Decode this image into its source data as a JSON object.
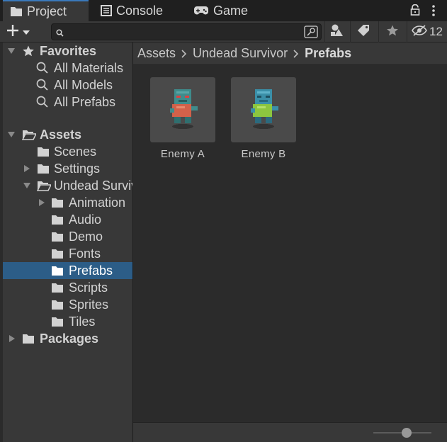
{
  "tabs": [
    {
      "label": "Project",
      "icon": "folder-icon",
      "active": true
    },
    {
      "label": "Console",
      "icon": "console-icon",
      "active": false
    },
    {
      "label": "Game",
      "icon": "gamepad-icon",
      "active": false
    }
  ],
  "toolbar": {
    "search_value": "",
    "hidden_count": "12"
  },
  "tree": {
    "favorites": {
      "label": "Favorites",
      "items": [
        {
          "label": "All Materials"
        },
        {
          "label": "All Models"
        },
        {
          "label": "All Prefabs"
        }
      ]
    },
    "assets": {
      "label": "Assets",
      "scenes": "Scenes",
      "settings": "Settings",
      "undead": "Undead Survivor",
      "children": [
        {
          "label": "Animation"
        },
        {
          "label": "Audio"
        },
        {
          "label": "Demo"
        },
        {
          "label": "Fonts"
        },
        {
          "label": "Prefabs"
        },
        {
          "label": "Scripts"
        },
        {
          "label": "Sprites"
        },
        {
          "label": "Tiles"
        }
      ]
    },
    "packages": {
      "label": "Packages"
    }
  },
  "breadcrumb": {
    "items": [
      "Assets",
      "Undead Survivor",
      "Prefabs"
    ]
  },
  "assets": [
    {
      "name": "Enemy A"
    },
    {
      "name": "Enemy B"
    }
  ],
  "footer": {
    "zoom": 0.5
  },
  "colors": {
    "selection": "#2c5d87",
    "active_tab_accent": "#3a79bb",
    "panel": "#383838",
    "content": "#2b2b2b"
  }
}
